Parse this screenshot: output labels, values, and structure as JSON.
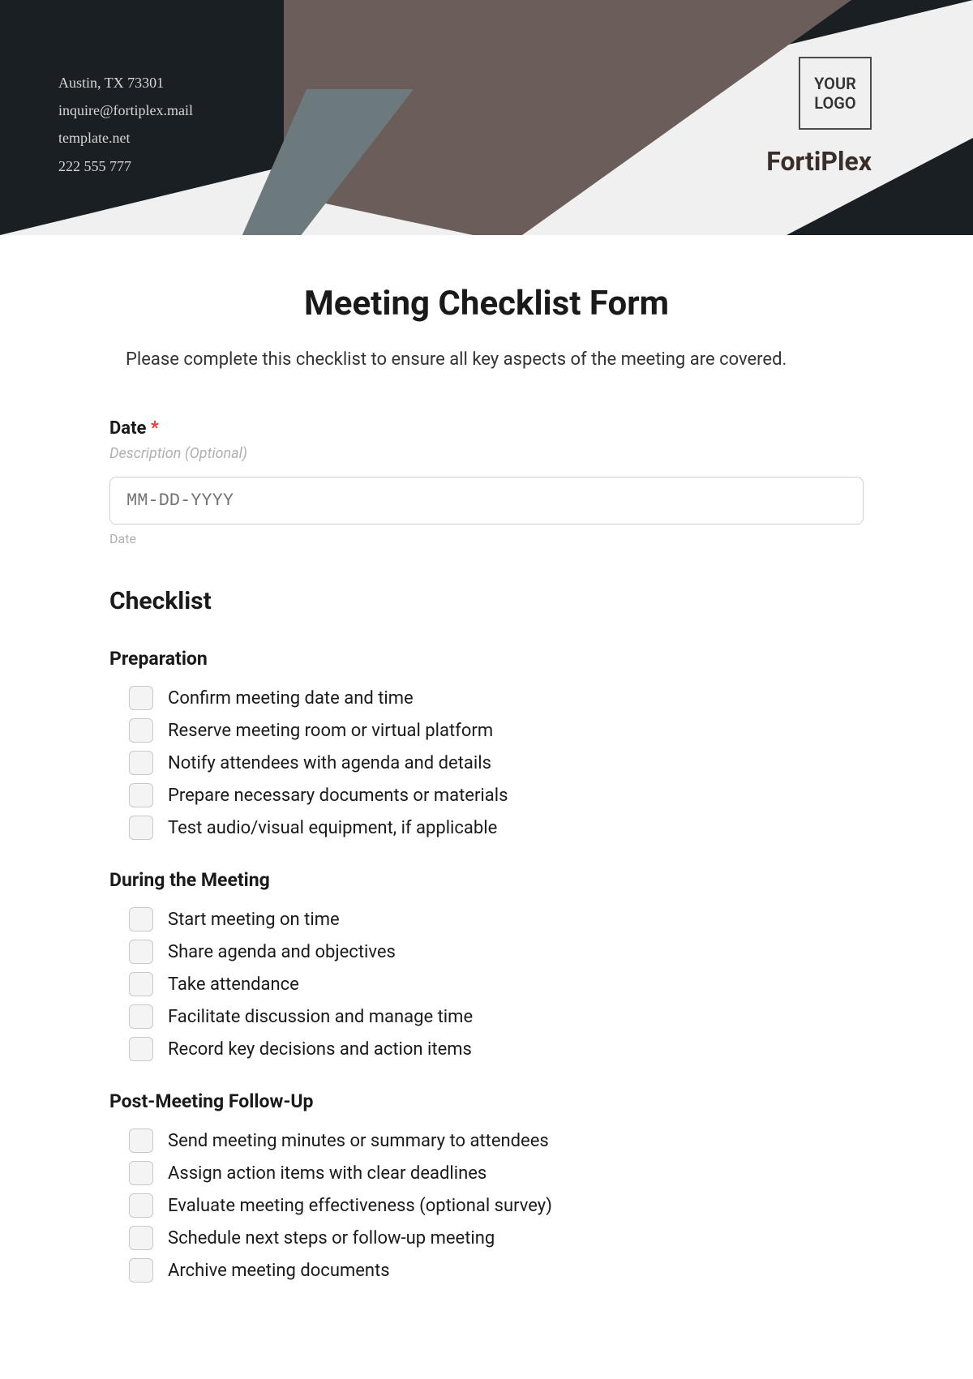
{
  "header": {
    "contact": {
      "address": "Austin, TX 73301",
      "email": "inquire@fortiplex.mail",
      "website": "template.net",
      "phone": "222 555 777"
    },
    "logoText": "YOUR LOGO",
    "brandName": "FortiPlex"
  },
  "form": {
    "title": "Meeting Checklist Form",
    "subtitle": "Please complete this checklist to ensure all key aspects of the meeting are covered.",
    "dateField": {
      "label": "Date",
      "required": "*",
      "description": "Description (Optional)",
      "placeholder": "MM-DD-YYYY",
      "sublabel": "Date"
    },
    "checklistHeading": "Checklist",
    "sections": [
      {
        "title": "Preparation",
        "items": [
          "Confirm meeting date and time",
          "Reserve meeting room or virtual platform",
          "Notify attendees with agenda and details",
          "Prepare necessary documents or materials",
          "Test audio/visual equipment, if applicable"
        ]
      },
      {
        "title": "During the Meeting",
        "items": [
          "Start meeting on time",
          "Share agenda and objectives",
          "Take attendance",
          "Facilitate discussion and manage time",
          "Record key decisions and action items"
        ]
      },
      {
        "title": "Post-Meeting Follow-Up",
        "items": [
          "Send meeting minutes or summary to attendees",
          "Assign action items with clear deadlines",
          "Evaluate meeting effectiveness (optional survey)",
          "Schedule next steps or follow-up meeting",
          "Archive meeting documents"
        ]
      }
    ]
  }
}
